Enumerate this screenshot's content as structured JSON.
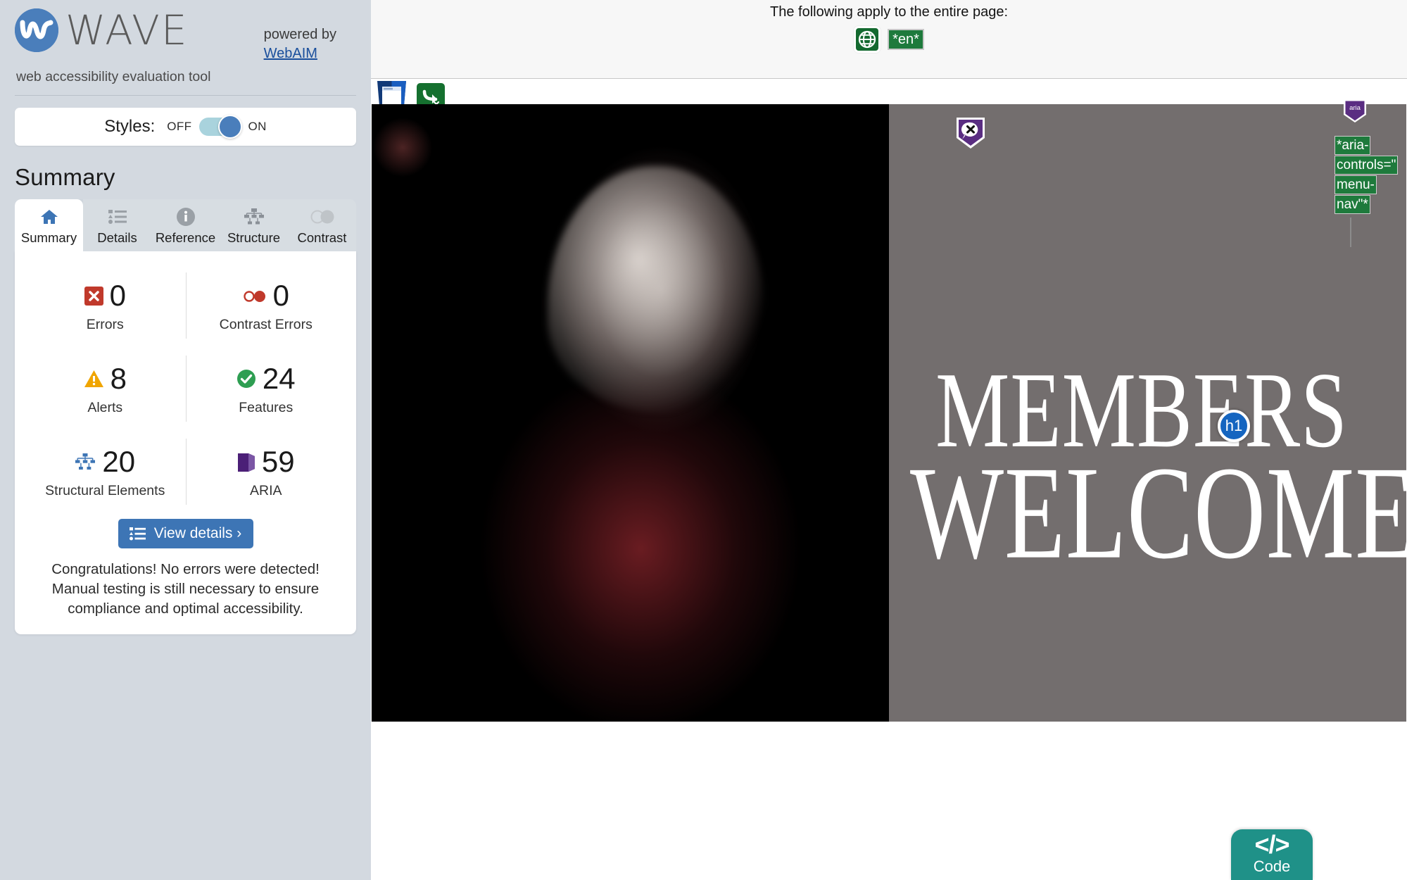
{
  "sidebar": {
    "brand": {
      "name": "WAVE",
      "tagline": "web accessibility evaluation tool",
      "logo_icon": "wave-logo-icon"
    },
    "powered_by": {
      "prefix": "powered by",
      "link": "WebAIM"
    },
    "styles_toggle": {
      "label": "Styles:",
      "off": "OFF",
      "on": "ON",
      "state": "ON"
    },
    "section_title": "Summary",
    "tabs": [
      {
        "label": "Summary",
        "icon": "home-icon",
        "active": true
      },
      {
        "label": "Details",
        "icon": "list-icon",
        "active": false
      },
      {
        "label": "Reference",
        "icon": "info-icon",
        "active": false
      },
      {
        "label": "Structure",
        "icon": "structure-icon",
        "active": false
      },
      {
        "label": "Contrast",
        "icon": "contrast-icon",
        "active": false
      }
    ],
    "stats": [
      {
        "value": "0",
        "label": "Errors",
        "icon": "error-x-icon",
        "color": "#c0392b"
      },
      {
        "value": "0",
        "label": "Contrast Errors",
        "icon": "contrast-dots-icon",
        "color": "#c0392b"
      },
      {
        "value": "8",
        "label": "Alerts",
        "icon": "alert-triangle-icon",
        "color": "#f0a500"
      },
      {
        "value": "24",
        "label": "Features",
        "icon": "check-circle-icon",
        "color": "#2e9e52"
      },
      {
        "value": "20",
        "label": "Structural Elements",
        "icon": "structure-icon",
        "color": "#3d75b5"
      },
      {
        "value": "59",
        "label": "ARIA",
        "icon": "aria-cube-icon",
        "color": "#5a2d82"
      }
    ],
    "details_button": {
      "label": "View details ›",
      "icon": "list-icon"
    },
    "congrats": "Congratulations! No errors were detected! Manual testing is still necessary to ensure compliance and optimal accessibility."
  },
  "content": {
    "page_banner": {
      "text": "The following apply to the entire page:",
      "globe_icon": "globe-icon",
      "lang_tag": "*en*"
    },
    "toolbar_icons": [
      {
        "name": "html5-document-icon"
      },
      {
        "name": "redirect-arrow-x-icon"
      }
    ],
    "markers": {
      "purple_badge": "alert-speech-bubble-x-icon",
      "h1_marker": "h1",
      "aria_badge": "aria",
      "aria_attribute_lines": [
        "*aria-",
        "controls=\"",
        "menu-",
        "nav\"*"
      ]
    },
    "hero": {
      "line1": "MEMBERS",
      "line2": "WELCOME",
      "background_color": "#736e6e"
    },
    "code_tab": {
      "glyph": "</>",
      "label": "Code"
    }
  }
}
